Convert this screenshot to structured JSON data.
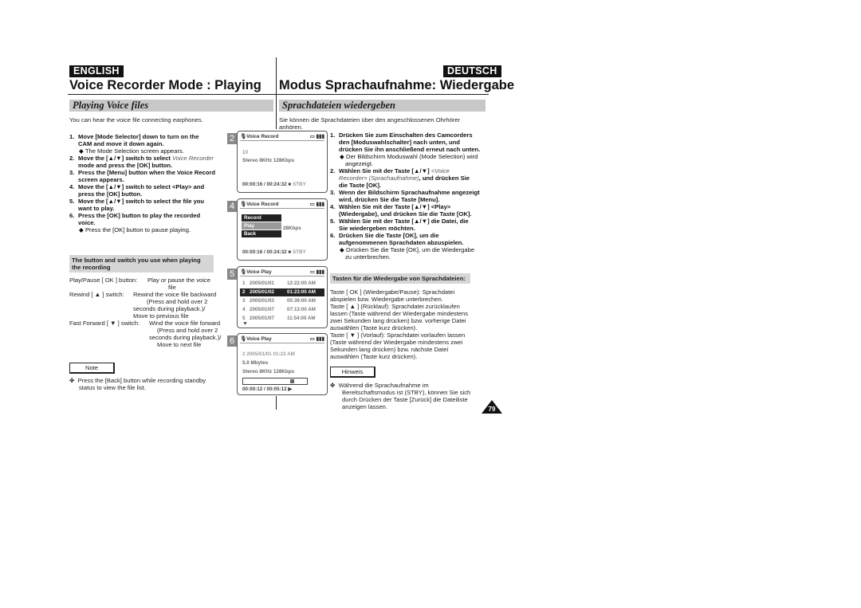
{
  "english": {
    "lang_badge": "ENGLISH",
    "title": "Voice Recorder Mode : Playing",
    "section": "Playing Voice files",
    "intro": "You can hear the voice file connecting earphones.",
    "steps": [
      {
        "n": "1.",
        "lines": [
          "Move [Mode Selector] down to turn on the",
          "CAM and move it down again."
        ],
        "sub": "The Mode Selection screen appears."
      },
      {
        "n": "2.",
        "lines_a": "Move the [▲/▼] switch to select ",
        "italic": "Voice Recorder",
        "lines_b": "mode and press the [OK] button."
      },
      {
        "n": "3.",
        "lines": [
          "Press the [Menu] button when the Voice Record",
          "screen appears."
        ]
      },
      {
        "n": "4.",
        "lines": [
          "Move the [▲/▼] switch to select <Play> and",
          "press the [OK] button."
        ]
      },
      {
        "n": "5.",
        "lines": [
          "Move the [▲/▼] switch to select the file you",
          "want to play."
        ]
      },
      {
        "n": "6.",
        "lines": [
          "Press the [OK] button to play the recorded",
          "voice."
        ],
        "sub": "Press the [OK] button to pause playing."
      }
    ],
    "controls_heading": [
      "The button and switch you use when playing",
      "the recording"
    ],
    "controls": [
      {
        "label": "Play/Pause [ OK ] button:",
        "desc": [
          "Play or pause the voice",
          "file"
        ]
      },
      {
        "label": "Rewind [ ▲ ] switch:",
        "desc": [
          "Rewind the voice file backward",
          "(Press and hold over 2",
          "seconds during playback.)/",
          "Move to previous file"
        ]
      },
      {
        "label": "Fast Forward [ ▼ ] switch:",
        "desc": [
          "Wind the voice file forward",
          "(Press and hold over 2",
          "seconds during playback.)/",
          "Move to next file"
        ]
      }
    ],
    "note_label": "Note",
    "note_text": [
      "Press the [Back] button while recording standby",
      "status to view the file list."
    ]
  },
  "deutsch": {
    "lang_badge": "DEUTSCH",
    "title": "Modus Sprachaufnahme: Wiedergabe",
    "section": "Sprachdateien wiedergeben",
    "intro": [
      "Sie können die Sprachdateien über den angeschlossenen Ohrhörer",
      "anhören."
    ],
    "steps": [
      {
        "n": "1.",
        "lines": [
          "Drücken Sie zum Einschalten des Camcorders",
          "den [Moduswahlschalter] nach unten, und",
          "drücken Sie ihn anschließend erneut nach unten."
        ],
        "sub": [
          "Der Bildschirm Moduswahl (Mode Selection) wird",
          "angezeigt."
        ]
      },
      {
        "n": "2.",
        "line1a": "Wählen Sie mit der Taste [▲/▼] ",
        "italic1": "<Voice",
        "italic2": "Recorder> (Sprachaufnahme)",
        "line2b": ", und drücken Sie",
        "line3": "die Taste [OK]."
      },
      {
        "n": "3.",
        "lines": [
          "Wenn der Bildschirm Sprachaufnahme angezeigt",
          "wird, drücken Sie die Taste [Menu]."
        ]
      },
      {
        "n": "4.",
        "lines": [
          "Wählen Sie mit der Taste [▲/▼] <Play>",
          "(Wiedergabe), und drücken Sie die Taste [OK]."
        ]
      },
      {
        "n": "5.",
        "lines": [
          "Wählen Sie mit der Taste [▲/▼] die Datei, die",
          "Sie wiedergeben möchten."
        ]
      },
      {
        "n": "6.",
        "lines": [
          "Drücken Sie die Taste [OK], um die",
          "aufgenommenen Sprachdaten abzuspielen."
        ],
        "sub": [
          "Drücken Sie die Taste [OK], um die Wiedergabe",
          "zu unterbrechen."
        ]
      }
    ],
    "controls_heading": "Tasten für die Wiedergabe von Sprachdateien:",
    "controls_text": [
      "Taste [ OK ] (Wiedergabe/Pause): Sprachdatei",
      "abspielen bzw. Wiedergabe unterbrechen.",
      "Taste [ ▲ ] (Rücklauf): Sprachdatei zurücklaufen",
      "lassen (Taste während der Wiedergabe mindestens",
      "zwei Sekunden lang drücken) bzw. vorherige Datei",
      "auswählen (Taste kurz drücken).",
      "Taste [ ▼ ] (Vorlauf): Sprachdatei vorlaufen lassen",
      "(Taste während der Wiedergabe mindestens zwei",
      "Sekunden lang drücken) bzw. nächste Datei",
      "auswählen (Taste kurz drücken)."
    ],
    "note_label": "Hinweis",
    "note_text": [
      "Während die Sprachaufnahme im",
      "Bereitschaftsmodus ist (STBY), können Sie sich",
      "durch Drücken der Taste [Zurück] die Dateiliste",
      "anzeigen lassen."
    ]
  },
  "screens": [
    {
      "step": "2",
      "title": "Voice Record",
      "icon": "microphone-icon",
      "lines": [
        "10",
        "Stereo  8KHz  128Kbps"
      ],
      "footer": "00:00:16 / 00:24:32",
      "status": "STBY"
    },
    {
      "step": "4",
      "title": "Voice Record",
      "icon": "microphone-icon",
      "menu": [
        "Record",
        "Play",
        "Back"
      ],
      "selected_menu": "Play",
      "partial": "28Kbps",
      "footer": "00:00:16 / 00:24:32",
      "status": "STBY"
    },
    {
      "step": "5",
      "title": "Voice Play",
      "icon": "microphone-icon",
      "files": [
        {
          "n": "1",
          "date": "2005/01/01",
          "time": "12:22:00 AM"
        },
        {
          "n": "2",
          "date": "2005/01/02",
          "time": "01:23:00 AM"
        },
        {
          "n": "3",
          "date": "2005/01/03",
          "time": "05:39:00 AM"
        },
        {
          "n": "4",
          "date": "2005/01/07",
          "time": "07:13:00 AM"
        },
        {
          "n": "5",
          "date": "2005/01/07",
          "time": "11:54:00 AM"
        }
      ],
      "selected_file": "2"
    },
    {
      "step": "6",
      "title": "Voice Play",
      "icon": "microphone-icon",
      "lines": [
        "2  2005/01/01  01:23 AM",
        "5.0 Mbytes",
        "Stereo  8KHz  128Kbps"
      ],
      "progress": 0.8,
      "footer": "00:00:12 / 00:05:12",
      "play_symbol": "▶"
    }
  ],
  "page_number": "79",
  "colors": {
    "section_bg": "#c8c8c8",
    "lang_bg": "#111111",
    "badge_bg": "#888888"
  }
}
